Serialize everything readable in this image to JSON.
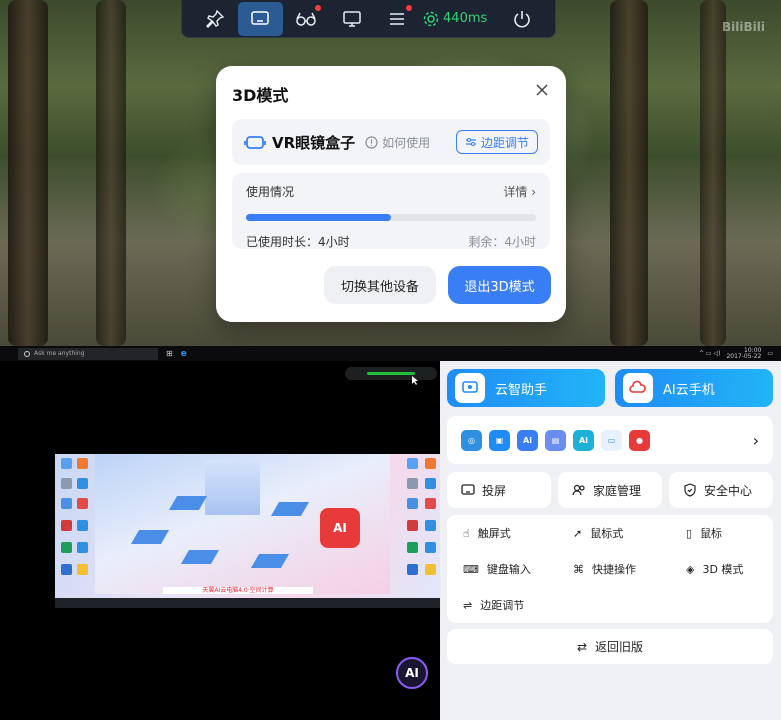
{
  "scene": {
    "watermark": "BiliBili"
  },
  "toolbar": {
    "buttons": [
      {
        "icon": "pin-icon"
      },
      {
        "icon": "cast-icon",
        "active": true
      },
      {
        "icon": "3d-glasses-icon",
        "badge": true
      },
      {
        "icon": "monitor-icon"
      },
      {
        "icon": "menu-icon",
        "badge": true
      },
      {
        "icon": "power-icon"
      }
    ],
    "latency": "440ms",
    "latency_color": "#33d17a"
  },
  "dialog": {
    "title": "3D模式",
    "device_name": "VR眼镜盒子",
    "howto": "如何使用",
    "adjust_label": "边距调节",
    "usage_label": "使用情况",
    "detail_label": "详情",
    "used": "已使用时长：4小时",
    "remaining": "剩余：4小时",
    "usage_fraction": 0.5,
    "switch_label": "切换其他设备",
    "exit_label": "退出3D模式",
    "accent": "#3a7ef5"
  },
  "taskbar": {
    "search_placeholder": "Ask me anything",
    "time": "10:00",
    "date": "2017-05-22"
  },
  "desktop": {
    "banner": "天翼AI云电脑4.0·空间计算"
  },
  "panel": {
    "assistant_label": "云智助手",
    "cloudphone_label": "AI云手机",
    "cast_label": "投屏",
    "family_label": "家庭管理",
    "security_label": "安全中心",
    "controls": {
      "touch": "触屏式",
      "mouse_mode": "鼠标式",
      "mouse": "鼠标",
      "keyboard": "键盘输入",
      "shortcut": "快捷操作",
      "mode3d": "3D 模式",
      "margin": "边距调节"
    },
    "legacy_label": "返回旧版"
  }
}
